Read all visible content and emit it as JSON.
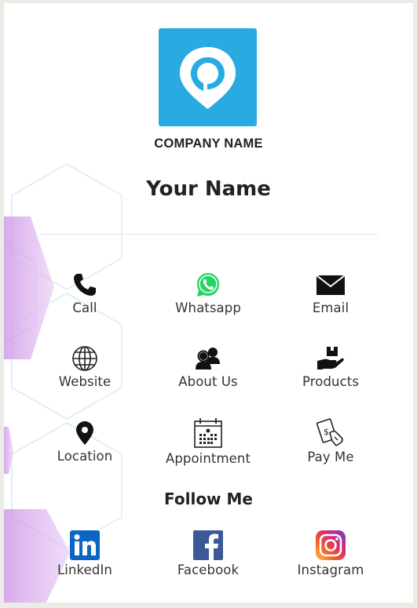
{
  "card": {
    "company_name": "COMPANY NAME",
    "person_name": "Your Name"
  },
  "actions": [
    {
      "label": "Call",
      "icon": "phone-icon"
    },
    {
      "label": "Whatsapp",
      "icon": "whatsapp-icon"
    },
    {
      "label": "Email",
      "icon": "envelope-icon"
    },
    {
      "label": "Website",
      "icon": "globe-icon"
    },
    {
      "label": "About Us",
      "icon": "people-icon"
    },
    {
      "label": "Products",
      "icon": "box-hand-icon"
    },
    {
      "label": "Location",
      "icon": "map-pin-icon"
    },
    {
      "label": "Appointment",
      "icon": "calendar-icon"
    },
    {
      "label": "Pay Me",
      "icon": "payment-icon"
    }
  ],
  "follow": {
    "heading": "Follow Me",
    "links": [
      {
        "label": "LinkedIn",
        "icon": "linkedin-icon"
      },
      {
        "label": "Facebook",
        "icon": "facebook-icon"
      },
      {
        "label": "Instagram",
        "icon": "instagram-icon"
      }
    ]
  },
  "colors": {
    "logo_bg": "#29abe2",
    "whatsapp": "#25d366",
    "linkedin": "#0a66c2",
    "facebook": "#3b5998",
    "accent_hex": "#d9a8ec"
  }
}
